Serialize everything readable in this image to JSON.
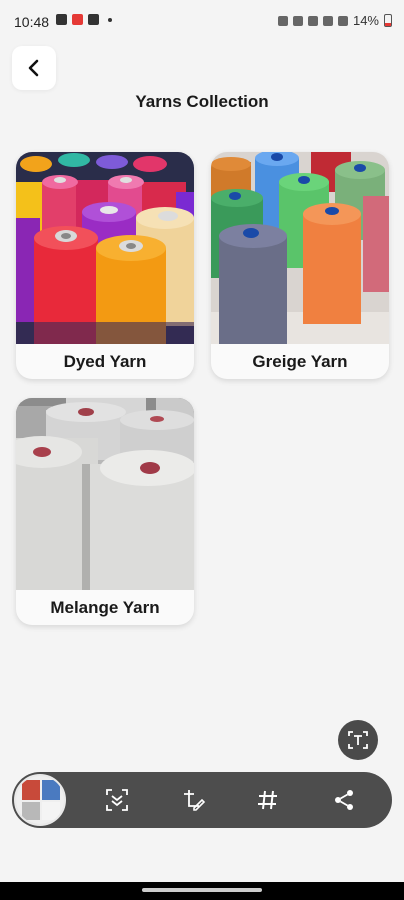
{
  "status_bar": {
    "time": "10:48",
    "battery": "14%"
  },
  "page": {
    "title": "Yarns Collection"
  },
  "categories": [
    {
      "label": "Dyed Yarn"
    },
    {
      "label": "Greige Yarn"
    },
    {
      "label": "Melange Yarn"
    }
  ],
  "icons": {
    "back": "arrow-left-icon",
    "scan_text": "scan-text-icon",
    "scroll_capture": "scroll-capture-icon",
    "edit": "edit-icon",
    "tag": "hashtag-icon",
    "share": "share-icon"
  },
  "colors": {
    "background": "#f4f4f4",
    "card": "#fafafa",
    "toolbar": "#4d4d4d"
  }
}
